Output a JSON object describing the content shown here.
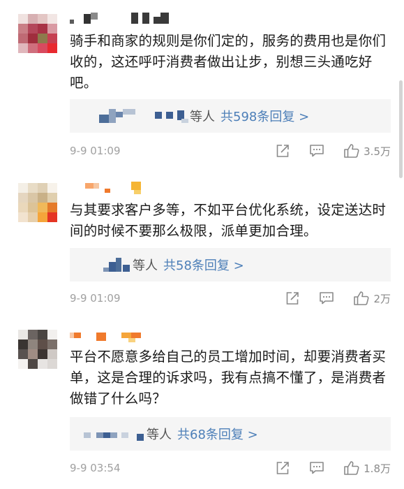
{
  "comments": [
    {
      "text": "骑手和商家的规则是你们定的，服务的费用也是你们收的，这还呼吁消费者做出让步，别想三头通吃好吧。",
      "reply_suffix": "等人",
      "reply_count_label": "共598条回复 >",
      "time": "9-9 01:09",
      "likes": "3.5万"
    },
    {
      "text": "与其要求客户多等，不如平台优化系统，设定送达时间的时候不要那么极限，派单更加合理。",
      "reply_suffix": "等人",
      "reply_count_label": "共58条回复 >",
      "time": "9-9 01:09",
      "likes": "2万"
    },
    {
      "text": "平台不愿意多给自己的员工增加时间，却要消费者买单，这是合理的诉求吗，我有点搞不懂了，是消费者做错了什么吗？",
      "reply_suffix": "等人",
      "reply_count_label": "共68条回复 >",
      "time": "9-9 03:54",
      "likes": "1.8万"
    }
  ],
  "icons": {
    "share": "share-icon",
    "comment": "comment-icon",
    "like": "thumbs-up-icon"
  },
  "colors": {
    "reply_link": "#4d7fb8",
    "meta_text": "#a0a0a0",
    "reply_bg": "#f5f5f5"
  }
}
